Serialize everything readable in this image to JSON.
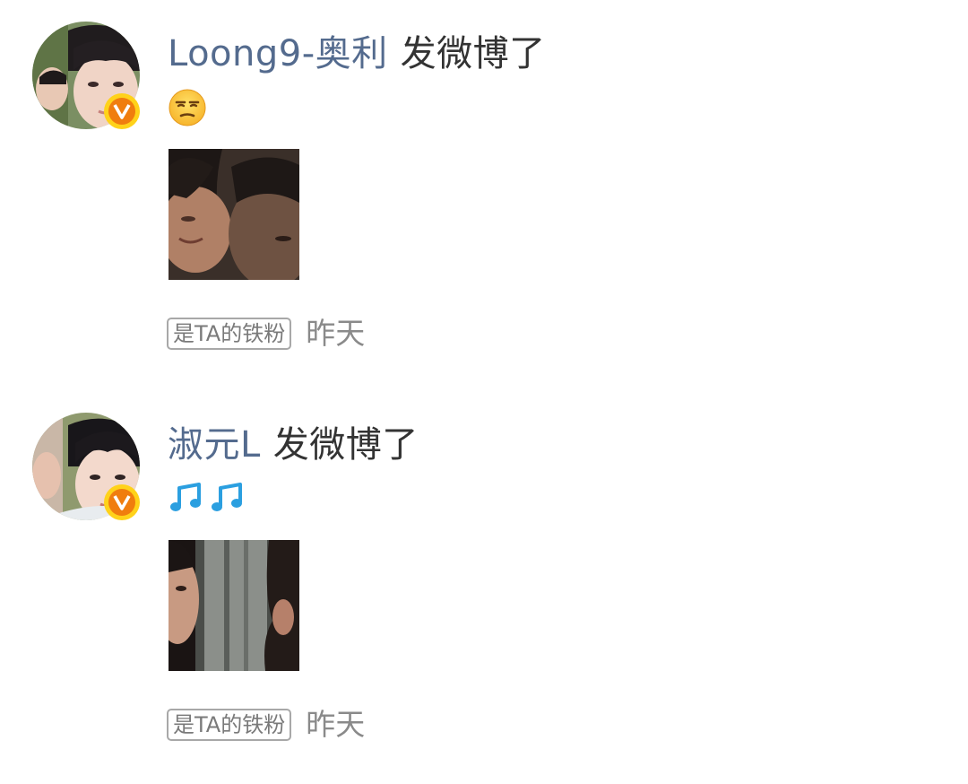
{
  "feed": [
    {
      "username": "Loong9-奥利",
      "action": "发微博了",
      "content_icons": [
        "unamused-face-emoji"
      ],
      "fan_badge": "是TA的铁粉",
      "timestamp": "昨天"
    },
    {
      "username": "淑元L",
      "action": "发微博了",
      "content_icons": [
        "music-notes-emoji",
        "music-notes-emoji"
      ],
      "fan_badge": "是TA的铁粉",
      "timestamp": "昨天"
    }
  ],
  "colors": {
    "username": "#546b8e",
    "action_text": "#333333",
    "meta_text": "#8a8a8a",
    "badge_border": "#a8a8a8",
    "verified_outer": "#ffd21a",
    "verified_inner": "#f07d0e"
  }
}
